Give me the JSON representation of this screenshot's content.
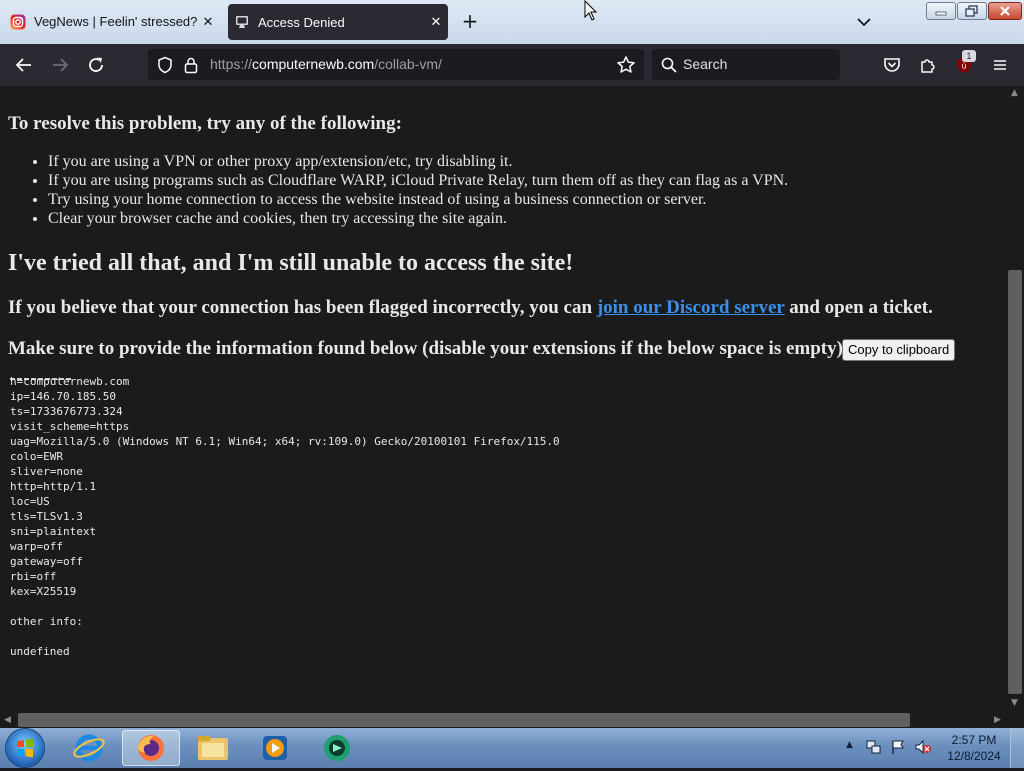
{
  "browser": {
    "tabs": [
      {
        "title": "VegNews | Feelin' stressed? 😰 C",
        "favicon": "instagram-icon",
        "active": false
      },
      {
        "title": "Access Denied",
        "favicon": "collabvm-icon",
        "active": true
      }
    ],
    "url": {
      "scheme": "https://",
      "host": "computernewb.com",
      "path": "/collab-vm/"
    },
    "search_placeholder": "Search",
    "extension_badge": "1"
  },
  "page": {
    "resolve_heading": "To resolve this problem, try any of the following:",
    "tips": [
      "If you are using a VPN or other proxy app/extension/etc, try disabling it.",
      "If you are using programs such as Cloudflare WARP, iCloud Private Relay, turn them off as they can flag as a VPN.",
      "Try using your home connection to access the website instead of using a business connection or server.",
      "Clear your browser cache and cookies, then try accessing the site again."
    ],
    "tried_heading": "I've tried all that, and I'm still unable to access the site!",
    "flagged_prefix": "If you believe that your connection has been flagged incorrectly, you can ",
    "discord_link": "join our Discord server",
    "flagged_suffix": " and open a ticket.",
    "provide_text": "Make sure to provide the information found below (disable your extensions if the below space is empty):",
    "copy_button": "Copy to clipboard",
    "info_text": "h=computernewb.com\nip=146.70.185.50\nts=1733676773.324\nvisit_scheme=https\nuag=Mozilla/5.0 (Windows NT 6.1; Win64; x64; rv:109.0) Gecko/20100101 Firefox/115.0\ncolo=EWR\nsliver=none\nhttp=http/1.1\nloc=US\ntls=TLSv1.3\nsni=plaintext\nwarp=off\ngateway=off\nrbi=off\nkex=X25519\n\nother info:\n\nundefined"
  },
  "taskbar": {
    "apps": [
      "internet-explorer-icon",
      "firefox-icon",
      "file-explorer-icon",
      "media-player-icon",
      "collabvm-app-icon"
    ],
    "time": "2:57 PM",
    "date": "12/8/2024"
  },
  "colors": {
    "page_background": "#1b1b1b",
    "link": "#3b8eea",
    "toolbar": "#2b2a33"
  }
}
